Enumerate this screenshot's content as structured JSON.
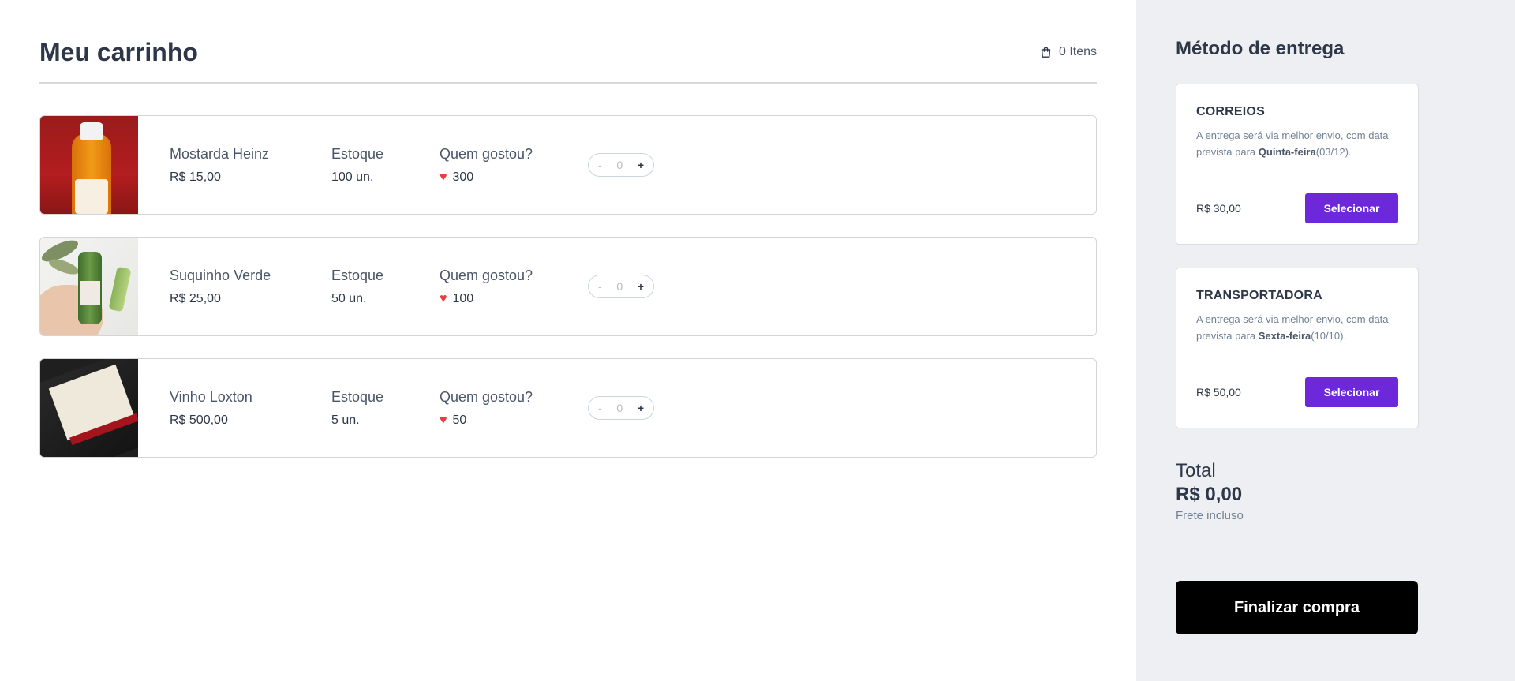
{
  "cart": {
    "title": "Meu carrinho",
    "items_count": "0 Itens",
    "products": [
      {
        "name": "Mostarda Heinz",
        "price": "R$ 15,00",
        "stock_label": "Estoque",
        "stock": "100 un.",
        "likes_label": "Quem gostou?",
        "likes": "300",
        "stepper": {
          "minus": "-",
          "qty": "0",
          "plus": "+"
        }
      },
      {
        "name": "Suquinho Verde",
        "price": "R$ 25,00",
        "stock_label": "Estoque",
        "stock": "50 un.",
        "likes_label": "Quem gostou?",
        "likes": "100",
        "stepper": {
          "minus": "-",
          "qty": "0",
          "plus": "+"
        }
      },
      {
        "name": "Vinho Loxton",
        "price": "R$ 500,00",
        "stock_label": "Estoque",
        "stock": "5 un.",
        "likes_label": "Quem gostou?",
        "likes": "50",
        "stepper": {
          "minus": "-",
          "qty": "0",
          "plus": "+"
        }
      }
    ]
  },
  "shipping": {
    "title": "Método de entrega",
    "options": [
      {
        "name": "CORREIOS",
        "desc_prefix": "A entrega será via melhor envio, com data prevista para ",
        "desc_day": "Quinta-feira",
        "desc_date": "(03/12).",
        "price": "R$ 30,00",
        "button": "Selecionar"
      },
      {
        "name": "TRANSPORTADORA",
        "desc_prefix": "A entrega será via melhor envio, com data prevista para ",
        "desc_day": "Sexta-feira",
        "desc_date": "(10/10).",
        "price": "R$ 50,00",
        "button": "Selecionar"
      }
    ]
  },
  "summary": {
    "total_label": "Total",
    "total_value": "R$ 0,00",
    "note": "Frete incluso",
    "checkout_button": "Finalizar compra"
  },
  "colors": {
    "accent": "#6d28d9",
    "sidebar_bg": "#eeeff3",
    "heart": "#e53e3e",
    "checkout": "#000000"
  },
  "icons": [
    "shopping-bag-icon",
    "heart-icon"
  ]
}
